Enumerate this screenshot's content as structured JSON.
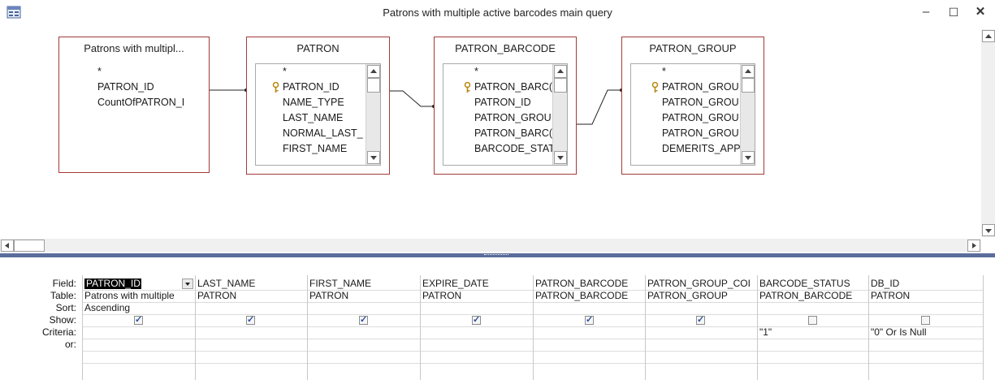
{
  "window": {
    "title": "Patrons with multiple active barcodes main query",
    "min_glyph": "–",
    "max_glyph": "☐",
    "close_glyph": "✕"
  },
  "tables": [
    {
      "title": "Patrons with multipl...",
      "fields": [
        "*",
        "PATRON_ID",
        "CountOfPATRON_I"
      ],
      "keys": [
        false,
        false,
        false
      ],
      "has_scrollbar": false
    },
    {
      "title": "PATRON",
      "fields": [
        "*",
        "PATRON_ID",
        "NAME_TYPE",
        "LAST_NAME",
        "NORMAL_LAST_",
        "FIRST_NAME"
      ],
      "keys": [
        false,
        true,
        false,
        false,
        false,
        false
      ],
      "has_scrollbar": true
    },
    {
      "title": "PATRON_BARCODE",
      "fields": [
        "*",
        "PATRON_BARC(",
        "PATRON_ID",
        "PATRON_GROU",
        "PATRON_BARC(",
        "BARCODE_STAT"
      ],
      "keys": [
        false,
        true,
        false,
        false,
        false,
        false
      ],
      "has_scrollbar": true
    },
    {
      "title": "PATRON_GROUP",
      "fields": [
        "*",
        "PATRON_GROU",
        "PATRON_GROU",
        "PATRON_GROU",
        "PATRON_GROU",
        "DEMERITS_APPL"
      ],
      "keys": [
        false,
        true,
        false,
        false,
        false,
        false
      ],
      "has_scrollbar": true
    }
  ],
  "grid": {
    "row_labels": [
      "Field:",
      "Table:",
      "Sort:",
      "Show:",
      "Criteria:",
      "or:"
    ],
    "columns": [
      {
        "field": "PATRON_ID",
        "table": "Patrons with multiple",
        "sort": "Ascending",
        "show": true,
        "criteria": "",
        "or": ""
      },
      {
        "field": "LAST_NAME",
        "table": "PATRON",
        "sort": "",
        "show": true,
        "criteria": "",
        "or": ""
      },
      {
        "field": "FIRST_NAME",
        "table": "PATRON",
        "sort": "",
        "show": true,
        "criteria": "",
        "or": ""
      },
      {
        "field": "EXPIRE_DATE",
        "table": "PATRON",
        "sort": "",
        "show": true,
        "criteria": "",
        "or": ""
      },
      {
        "field": "PATRON_BARCODE",
        "table": "PATRON_BARCODE",
        "sort": "",
        "show": true,
        "criteria": "",
        "or": ""
      },
      {
        "field": "PATRON_GROUP_COI",
        "table": "PATRON_GROUP",
        "sort": "",
        "show": true,
        "criteria": "",
        "or": ""
      },
      {
        "field": "BARCODE_STATUS",
        "table": "PATRON_BARCODE",
        "sort": "",
        "show": false,
        "criteria": "\"1\"",
        "or": ""
      },
      {
        "field": "DB_ID",
        "table": "PATRON",
        "sort": "",
        "show": false,
        "criteria": "\"0\" Or Is Null",
        "or": ""
      }
    ]
  },
  "colors": {
    "table_border": "#a33a3a",
    "splitter": "#5b6d9c",
    "check_mark": "#2a4fa6"
  }
}
